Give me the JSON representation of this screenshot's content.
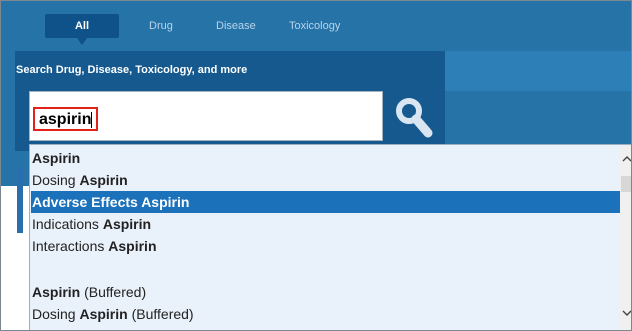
{
  "tabs": [
    {
      "label": "All",
      "active": true
    },
    {
      "label": "Drug"
    },
    {
      "label": "Disease"
    },
    {
      "label": "Toxicology"
    }
  ],
  "search": {
    "title": "Search Drug, Disease, Toxicology, and more",
    "value": "aspirin",
    "icon": "search-icon"
  },
  "suggestions": [
    {
      "prefix": "",
      "bold": "Aspirin",
      "suffix": ""
    },
    {
      "prefix": "Dosing ",
      "bold": "Aspirin",
      "suffix": ""
    },
    {
      "prefix": "",
      "bold": "Adverse Effects Aspirin",
      "suffix": "",
      "selected": true
    },
    {
      "prefix": "Indications ",
      "bold": "Aspirin",
      "suffix": ""
    },
    {
      "prefix": "Interactions ",
      "bold": "Aspirin",
      "suffix": ""
    },
    {
      "prefix": "",
      "bold": "Aspirin",
      "suffix": " (Buffered)"
    },
    {
      "prefix": "Dosing ",
      "bold": "Aspirin",
      "suffix": " (Buffered)"
    }
  ],
  "colors": {
    "header": "#2673a8",
    "panel": "#15598f",
    "active_tab": "#0e5289",
    "selected_row": "#1b71ba",
    "highlight_border": "#e2231a"
  }
}
